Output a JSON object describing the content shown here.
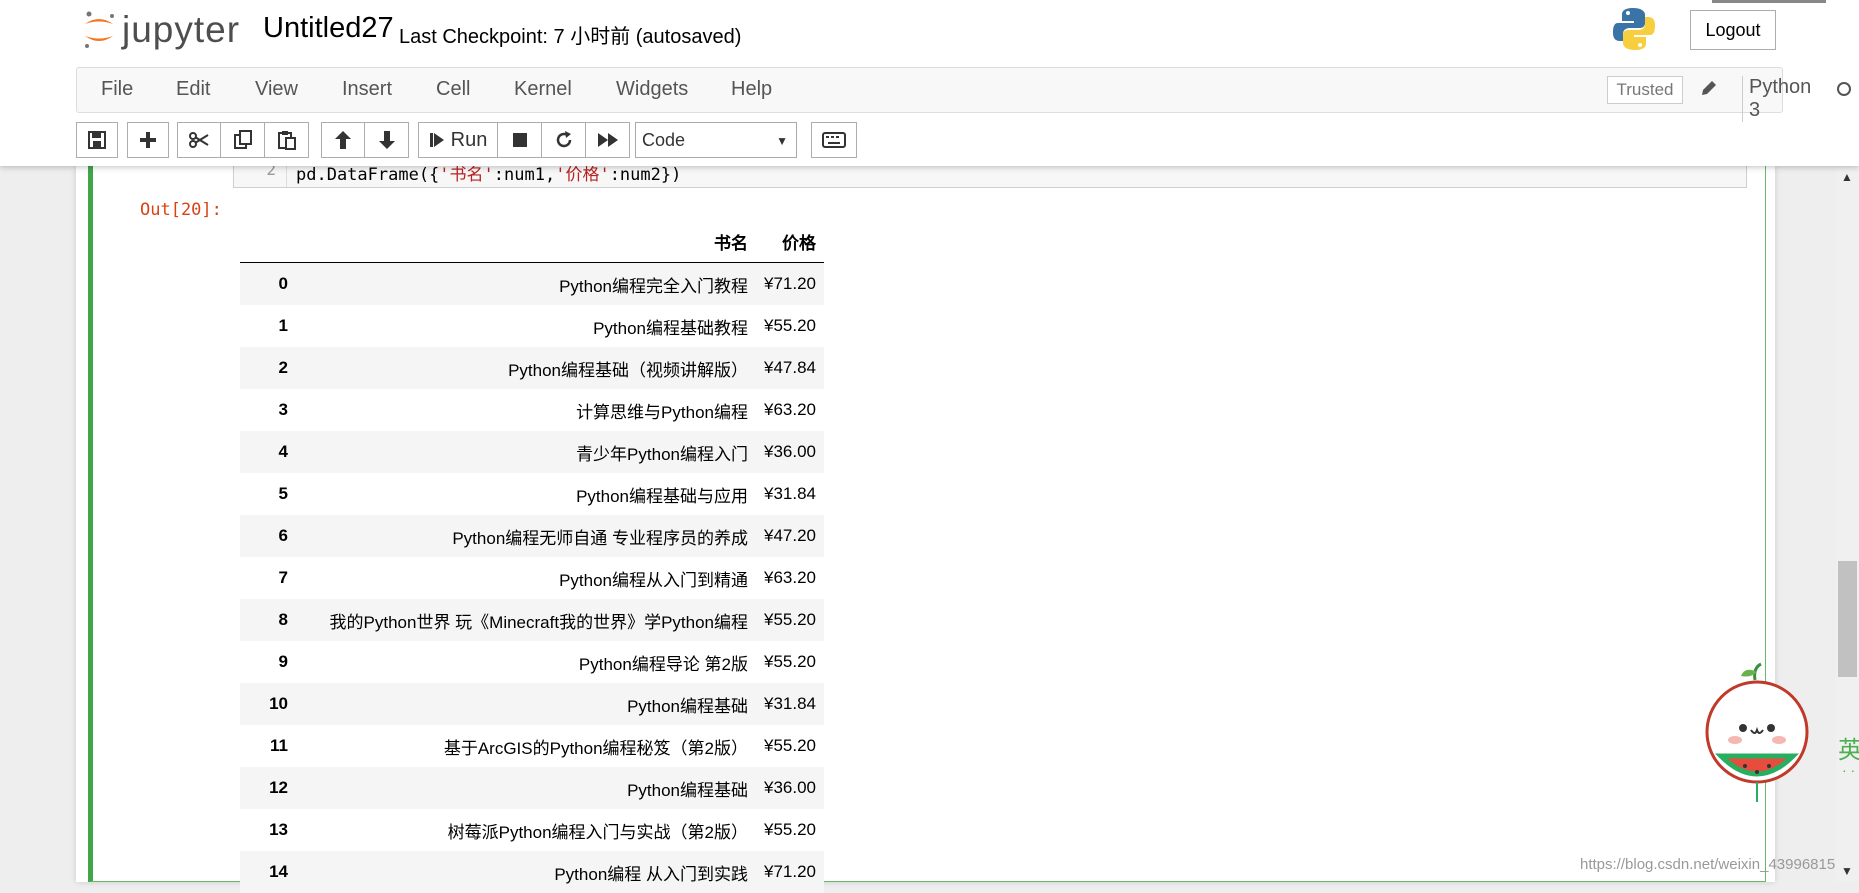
{
  "header": {
    "logo_text": "jupyter",
    "notebook_title": "Untitled27",
    "checkpoint_text": "Last Checkpoint: 7 小时前   (autosaved)",
    "logout_label": "Logout"
  },
  "menubar": {
    "items": [
      "File",
      "Edit",
      "View",
      "Insert",
      "Cell",
      "Kernel",
      "Widgets",
      "Help"
    ],
    "trusted_label": "Trusted",
    "kernel_name": "Python 3"
  },
  "toolbar": {
    "run_label": "Run",
    "cell_type": "Code"
  },
  "cell": {
    "line_number": "2",
    "code_prefix": "pd.DataFrame({",
    "code_key1": "'书名'",
    "code_mid": ":num1,",
    "code_key2": "'价格'",
    "code_suffix": ":num2})",
    "out_prompt": "Out[20]:"
  },
  "dataframe": {
    "columns": [
      "书名",
      "价格"
    ],
    "rows": [
      {
        "index": "0",
        "name": "Python编程完全入门教程",
        "price": "¥71.20"
      },
      {
        "index": "1",
        "name": "Python编程基础教程",
        "price": "¥55.20"
      },
      {
        "index": "2",
        "name": "Python编程基础（视频讲解版）",
        "price": "¥47.84"
      },
      {
        "index": "3",
        "name": "计算思维与Python编程",
        "price": "¥63.20"
      },
      {
        "index": "4",
        "name": "青少年Python编程入门",
        "price": "¥36.00"
      },
      {
        "index": "5",
        "name": "Python编程基础与应用",
        "price": "¥31.84"
      },
      {
        "index": "6",
        "name": "Python编程无师自通 专业程序员的养成",
        "price": "¥47.20"
      },
      {
        "index": "7",
        "name": "Python编程从入门到精通",
        "price": "¥63.20"
      },
      {
        "index": "8",
        "name": "我的Python世界 玩《Minecraft我的世界》学Python编程",
        "price": "¥55.20"
      },
      {
        "index": "9",
        "name": "Python编程导论 第2版",
        "price": "¥55.20"
      },
      {
        "index": "10",
        "name": "Python编程基础",
        "price": "¥31.84"
      },
      {
        "index": "11",
        "name": "基于ArcGIS的Python编程秘笈（第2版）",
        "price": "¥55.20"
      },
      {
        "index": "12",
        "name": "Python编程基础",
        "price": "¥36.00"
      },
      {
        "index": "13",
        "name": "树莓派Python编程入门与实战（第2版）",
        "price": "¥55.20"
      },
      {
        "index": "14",
        "name": "Python编程 从入门到实践",
        "price": "¥71.20"
      }
    ]
  },
  "side": {
    "hanzi": "英",
    "dots": "· ·",
    "watermark": "https://blog.csdn.net/weixin_43996815"
  },
  "colors": {
    "cell_border": "#42a548",
    "out_prompt": "#d84315",
    "jupyter_orange": "#f37726"
  },
  "icons": [
    "save-icon",
    "plus-icon",
    "cut-icon",
    "copy-icon",
    "paste-icon",
    "arrow-up-icon",
    "arrow-down-icon",
    "step-forward-icon",
    "stop-icon",
    "refresh-icon",
    "fast-forward-icon",
    "keyboard-icon",
    "pencil-icon",
    "python-logo-icon",
    "kernel-idle-icon"
  ]
}
